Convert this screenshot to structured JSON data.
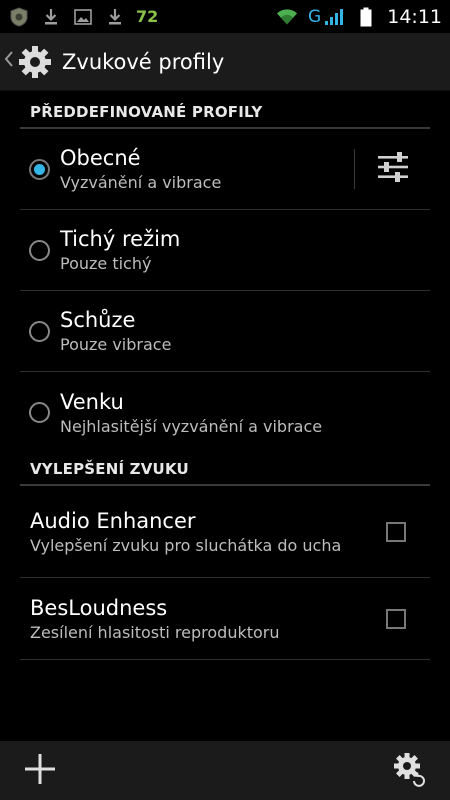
{
  "status_bar": {
    "notification_number": "72",
    "network_letter": "G",
    "time": "14:11"
  },
  "action_bar": {
    "title": "Zvukové profily"
  },
  "sections": {
    "profiles": {
      "header": "PŘEDDEFINOVANÉ PROFILY",
      "items": [
        {
          "title": "Obecné",
          "summary": "Vyzvánění a vibrace",
          "selected": true
        },
        {
          "title": "Tichý režim",
          "summary": "Pouze tichý",
          "selected": false
        },
        {
          "title": "Schůze",
          "summary": "Pouze vibrace",
          "selected": false
        },
        {
          "title": "Venku",
          "summary": "Nejhlasitější vyzvánění a vibrace",
          "selected": false
        }
      ]
    },
    "enhancement": {
      "header": "VYLEPŠENÍ ZVUKU",
      "items": [
        {
          "title": "Audio Enhancer",
          "summary": "Vylepšení zvuku pro sluchátka do ucha",
          "checked": false
        },
        {
          "title": "BesLoudness",
          "summary": "Zesílení hlasitosti reproduktoru",
          "checked": false
        }
      ]
    }
  },
  "colors": {
    "accent": "#33b5e5",
    "background": "#000000",
    "bar": "#1b1b1b"
  }
}
